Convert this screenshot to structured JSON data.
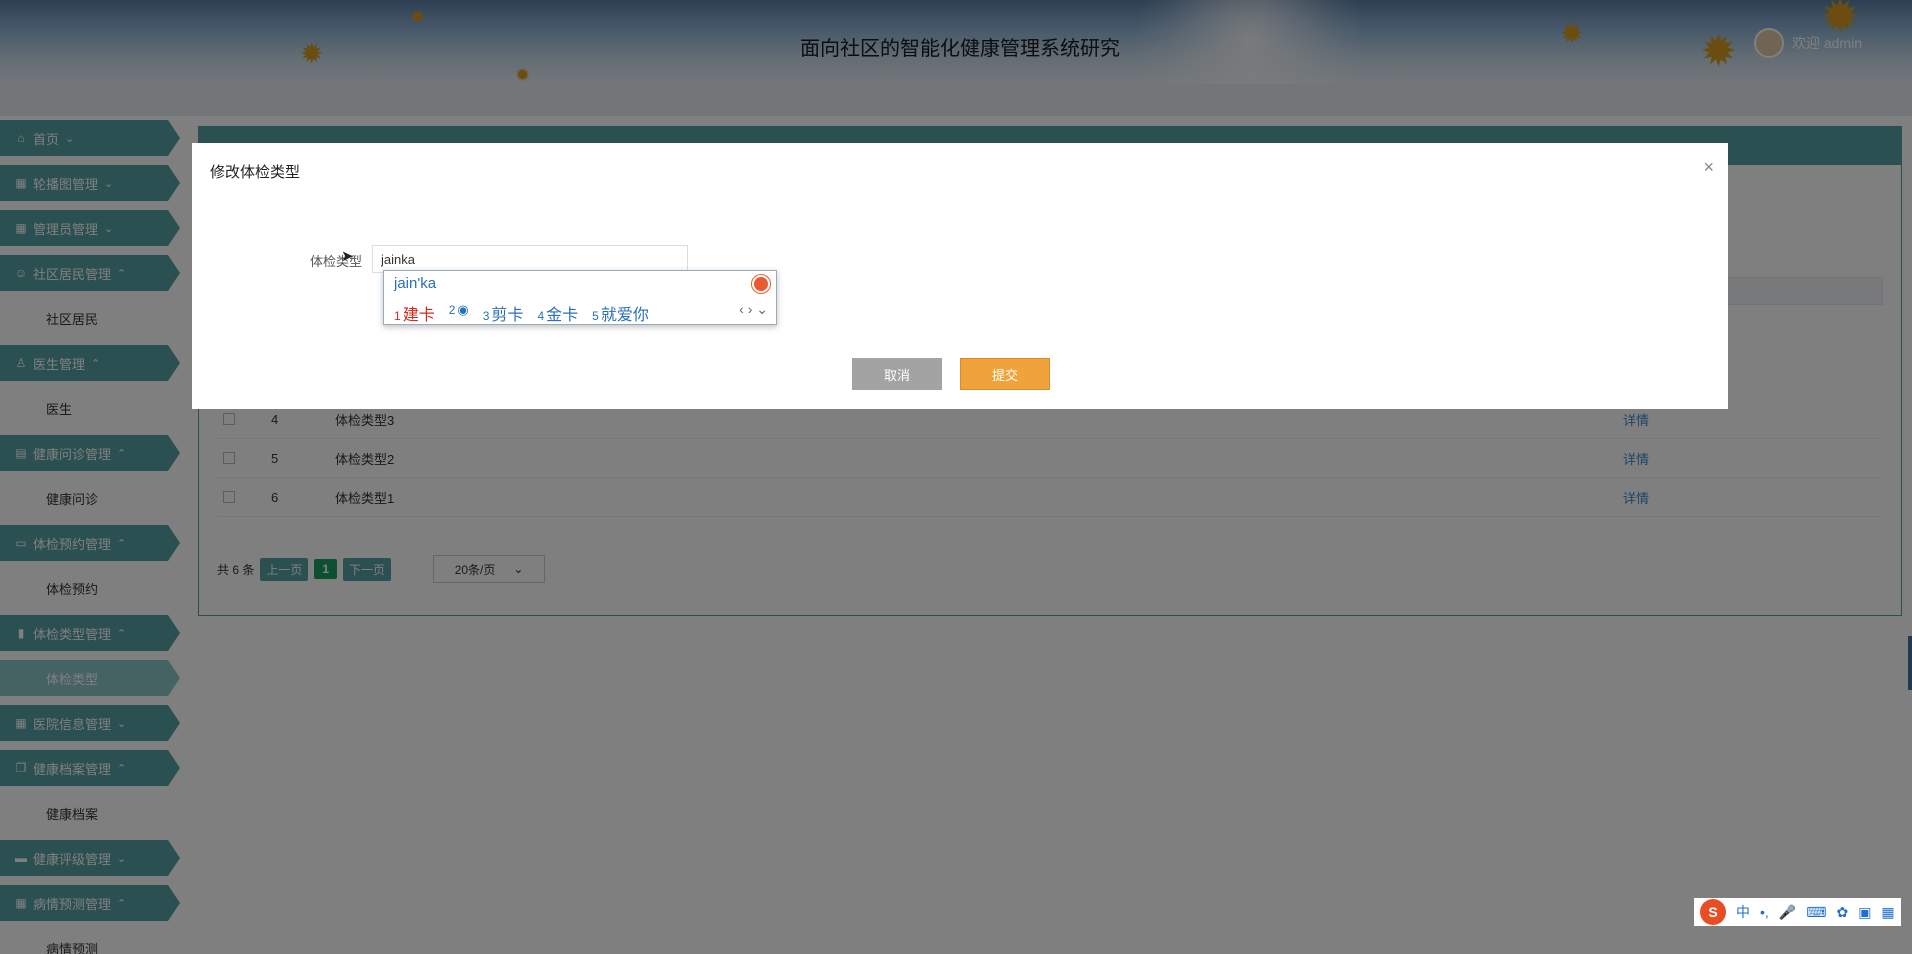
{
  "header": {
    "title": "面向社区的智能化健康管理系统研究",
    "welcome": "欢迎 admin"
  },
  "sidebar": {
    "items": [
      {
        "label": "首页",
        "icon": "home-icon",
        "chevron": "⌄"
      },
      {
        "label": "轮播图管理",
        "icon": "grid-icon",
        "chevron": "⌄"
      },
      {
        "label": "管理员管理",
        "icon": "grid-icon",
        "chevron": "⌄"
      },
      {
        "label": "社区居民管理",
        "icon": "user-icon",
        "chevron": "⌃"
      },
      {
        "label": "社区居民",
        "sub": true
      },
      {
        "label": "医生管理",
        "icon": "person-icon",
        "chevron": "⌃"
      },
      {
        "label": "医生",
        "sub": true
      },
      {
        "label": "健康问诊管理",
        "icon": "doc-icon",
        "chevron": "⌃"
      },
      {
        "label": "健康问诊",
        "sub": true
      },
      {
        "label": "体检预约管理",
        "icon": "bus-icon",
        "chevron": "⌃"
      },
      {
        "label": "体检预约",
        "sub": true
      },
      {
        "label": "体检类型管理",
        "icon": "list-icon",
        "chevron": "⌃"
      },
      {
        "label": "体检类型",
        "sub": true,
        "active": true
      },
      {
        "label": "医院信息管理",
        "icon": "grid-icon",
        "chevron": "⌄"
      },
      {
        "label": "健康档案管理",
        "icon": "copy-icon",
        "chevron": "⌃"
      },
      {
        "label": "健康档案",
        "sub": true
      },
      {
        "label": "健康评级管理",
        "icon": "table-icon",
        "chevron": "⌄"
      },
      {
        "label": "病情预测管理",
        "icon": "grid-icon",
        "chevron": "⌃"
      },
      {
        "label": "病情预测",
        "sub": true
      }
    ]
  },
  "table": {
    "rows": [
      {
        "num": "4",
        "name": "体检类型3",
        "action": "详情"
      },
      {
        "num": "5",
        "name": "体检类型2",
        "action": "详情"
      },
      {
        "num": "6",
        "name": "体检类型1",
        "action": "详情"
      }
    ]
  },
  "pager": {
    "total": "共 6 条",
    "prev": "上一页",
    "page": "1",
    "next": "下一页",
    "size": "20条/页"
  },
  "dialog": {
    "title": "修改体检类型",
    "close": "×",
    "field_label": "体检类型",
    "field_value": "jainka",
    "cancel": "取消",
    "submit": "提交"
  },
  "ime": {
    "pinyin": "jain'ka",
    "candidates": [
      {
        "idx": "1",
        "text": "建卡"
      },
      {
        "idx": "2",
        "text": ""
      },
      {
        "idx": "3",
        "text": "剪卡"
      },
      {
        "idx": "4",
        "text": "金卡"
      },
      {
        "idx": "5",
        "text": "就爱你"
      }
    ]
  },
  "tray": {
    "lang": "中"
  },
  "colors": {
    "accent": "#57a0a4",
    "submit": "#f1a33b",
    "cancel": "#a3a3a3",
    "link": "#3a8bc9"
  }
}
